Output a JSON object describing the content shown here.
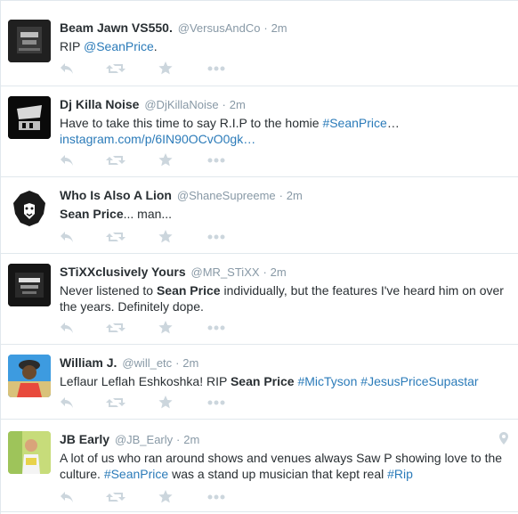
{
  "tweets": [
    {
      "fullname": "Beam Jawn VS550.",
      "username": "@VersusAndCo",
      "time": "2m",
      "text": [
        {
          "t": "RIP ",
          "k": "plain"
        },
        {
          "t": "@SeanPrice",
          "k": "mention"
        },
        {
          "t": ".",
          "k": "plain"
        }
      ]
    },
    {
      "fullname": "Dj Killa Noise",
      "username": "@DjKillaNoise",
      "time": "2m",
      "text": [
        {
          "t": "Have to take this time to say R.I.P to the homie ",
          "k": "plain"
        },
        {
          "t": "#SeanPrice",
          "k": "hashtag"
        },
        {
          "t": "…",
          "k": "plain"
        },
        {
          "t": "instagram.com/p/6IN90OCvO0gk…",
          "k": "link"
        }
      ]
    },
    {
      "fullname": "Who Is Also A Lion",
      "username": "@ShaneSupreeme",
      "time": "2m",
      "text": [
        {
          "t": "Sean Price",
          "k": "bold"
        },
        {
          "t": "... man...",
          "k": "plain"
        }
      ]
    },
    {
      "fullname": "STiXXclusively Yours",
      "username": "@MR_STiXX",
      "time": "2m",
      "text": [
        {
          "t": "Never listened to ",
          "k": "plain"
        },
        {
          "t": "Sean Price",
          "k": "bold"
        },
        {
          "t": " individually, but the features I've heard him on over the years. Definitely dope.",
          "k": "plain"
        }
      ]
    },
    {
      "fullname": "William J.",
      "username": "@will_etc",
      "time": "2m",
      "text": [
        {
          "t": "Leflaur Leflah Eshkoshka! RIP ",
          "k": "plain"
        },
        {
          "t": "Sean Price",
          "k": "bold"
        },
        {
          "t": " ",
          "k": "plain"
        },
        {
          "t": "#MicTyson",
          "k": "hashtag"
        },
        {
          "t": " ",
          "k": "plain"
        },
        {
          "t": "#JesusPriceSupastar",
          "k": "hashtag"
        }
      ]
    },
    {
      "fullname": "JB Early",
      "username": "@JB_Early",
      "time": "2m",
      "text": [
        {
          "t": "A lot of us who ran around shows and venues always Saw P showing love to the culture. ",
          "k": "plain"
        },
        {
          "t": "#SeanPrice",
          "k": "hashtag"
        },
        {
          "t": " was a stand up musician that kept real ",
          "k": "plain"
        },
        {
          "t": "#Rip",
          "k": "hashtag"
        }
      ]
    }
  ],
  "colors": {
    "link": "#2b7bb9",
    "meta": "#8899a6",
    "text": "#292f33",
    "action_icon": "#ccd6dd",
    "border": "#e1e8ed"
  },
  "icons": [
    "reply-icon",
    "retweet-icon",
    "favorite-icon",
    "more-icon",
    "geo-pin-icon"
  ]
}
